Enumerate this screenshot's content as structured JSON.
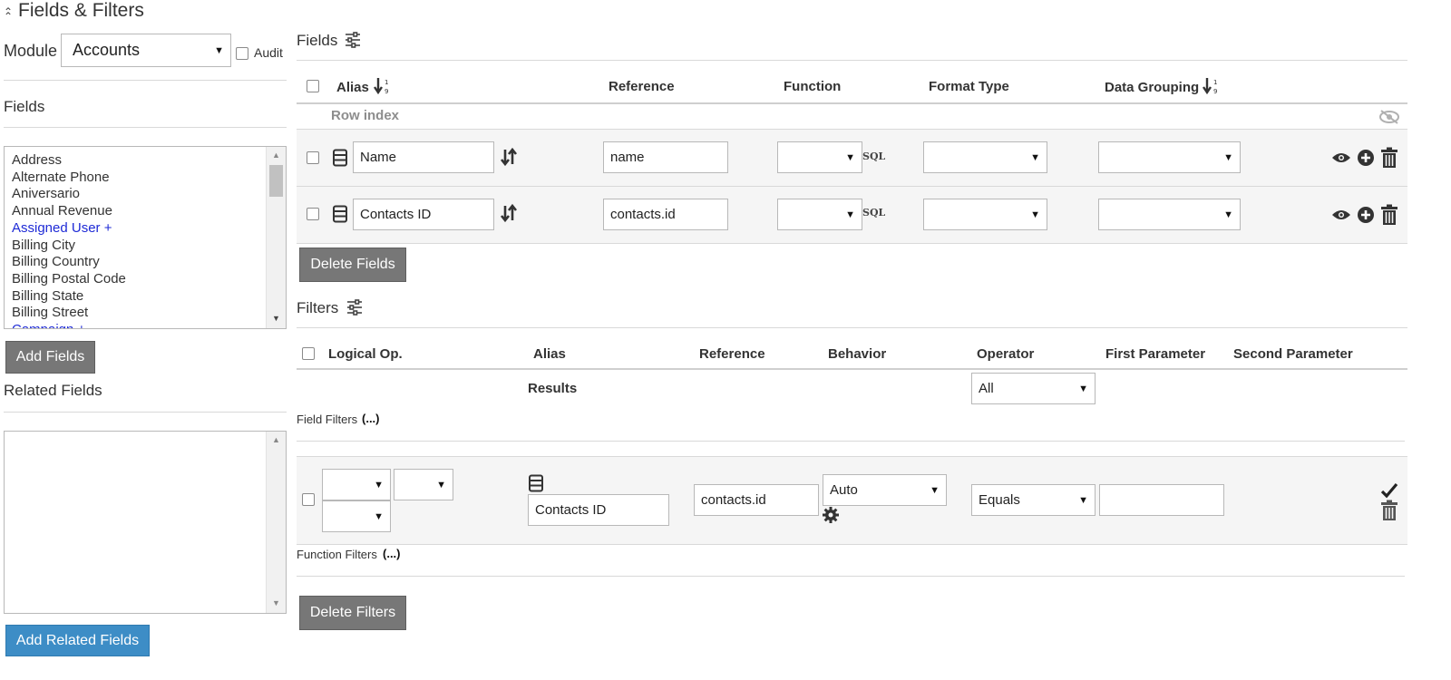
{
  "panel": {
    "title": "Fields & Filters"
  },
  "module": {
    "label": "Module",
    "selected": "Accounts",
    "audit_label": "Audit"
  },
  "left": {
    "fields_heading": "Fields",
    "fields_list": [
      {
        "label": "Address",
        "link": false
      },
      {
        "label": "Alternate Phone",
        "link": false
      },
      {
        "label": "Aniversario",
        "link": false
      },
      {
        "label": "Annual Revenue",
        "link": false
      },
      {
        "label": "Assigned User +",
        "link": true
      },
      {
        "label": "Billing City",
        "link": false
      },
      {
        "label": "Billing Country",
        "link": false
      },
      {
        "label": "Billing Postal Code",
        "link": false
      },
      {
        "label": "Billing State",
        "link": false
      },
      {
        "label": "Billing Street",
        "link": false
      },
      {
        "label": "Campaign +",
        "link": true
      }
    ],
    "add_fields_button": "Add Fields",
    "related_heading": "Related Fields",
    "add_related_button": "Add Related Fields"
  },
  "fields_section": {
    "title": "Fields",
    "columns": {
      "alias": "Alias",
      "reference": "Reference",
      "function": "Function",
      "format_type": "Format Type",
      "data_grouping": "Data Grouping"
    },
    "row_index_label": "Row index",
    "rows": [
      {
        "alias": "Name",
        "reference": "name",
        "function": "",
        "format_type": "",
        "data_grouping": ""
      },
      {
        "alias": "Contacts ID",
        "reference": "contacts.id",
        "function": "",
        "format_type": "",
        "data_grouping": ""
      }
    ],
    "sql_tag": "SQL",
    "delete_button": "Delete Fields"
  },
  "filters_section": {
    "title": "Filters",
    "columns": {
      "logical_op": "Logical Op.",
      "alias": "Alias",
      "reference": "Reference",
      "behavior": "Behavior",
      "operator": "Operator",
      "first_param": "First Parameter",
      "second_param": "Second Parameter"
    },
    "results_label": "Results",
    "results_value": "All",
    "field_filters_label": "Field Filters",
    "function_filters_label": "Function Filters",
    "ellipsis": "(...)",
    "row": {
      "alias": "Contacts ID",
      "reference": "contacts.id",
      "behavior": "Auto",
      "operator": "Equals",
      "first_param": ""
    },
    "delete_button": "Delete Filters"
  },
  "colors": {
    "button_gray": "#777777",
    "button_blue": "#3d8dc6",
    "link_blue": "#1e2ad6"
  }
}
